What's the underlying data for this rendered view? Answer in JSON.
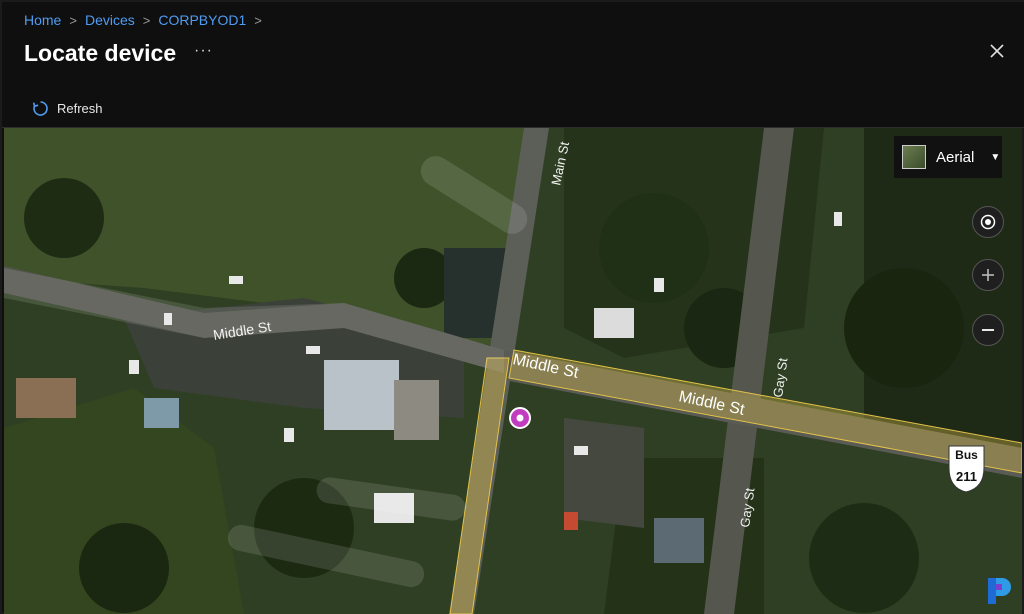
{
  "breadcrumb": {
    "items": [
      "Home",
      "Devices",
      "CORPBYOD1"
    ],
    "separator": ">"
  },
  "page": {
    "title": "Locate device",
    "more_label": "···"
  },
  "toolbar": {
    "refresh_label": "Refresh"
  },
  "map": {
    "map_type_label": "Aerial",
    "street_labels": {
      "main": "Main St",
      "middle_west": "Middle St",
      "middle_east_1": "Middle St",
      "middle_east_2": "Middle St",
      "gay_1": "Gay St",
      "gay_2": "Gay St"
    },
    "route_shield": {
      "top": "Bus",
      "number": "211"
    },
    "pin_color": "#c13dbf"
  },
  "icons": {
    "close": "close-icon",
    "refresh": "refresh-icon",
    "locate": "locate-icon",
    "zoom_in": "zoom-in-icon",
    "zoom_out": "zoom-out-icon",
    "caret": "chevron-down-icon",
    "logo": "brand-logo"
  },
  "colors": {
    "link": "#4f9cf2",
    "road_overlay": "#e3c24a",
    "background": "#0f0f10"
  }
}
